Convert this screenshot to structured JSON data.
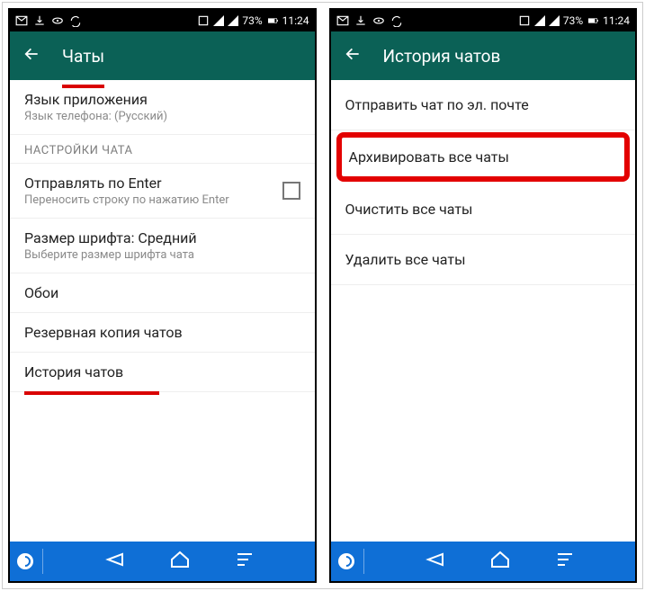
{
  "status": {
    "battery": "73%",
    "time": "11:24"
  },
  "left": {
    "title": "Чаты",
    "lang_title": "Язык приложения",
    "lang_sub": "Язык телефона: (Русский)",
    "section": "НАСТРОЙКИ ЧАТА",
    "enter_title": "Отправлять по Enter",
    "enter_sub": "Переносить строку по нажатию Enter",
    "font_title": "Размер шрифта: Средний",
    "font_sub": "Выберите размер шрифта чата",
    "wallpaper": "Обои",
    "backup": "Резервная копия чатов",
    "history": "История чатов"
  },
  "right": {
    "title": "История чатов",
    "email": "Отправить чат по эл. почте",
    "archive": "Архивировать все чаты",
    "clear": "Очистить все чаты",
    "delete": "Удалить все чаты"
  }
}
